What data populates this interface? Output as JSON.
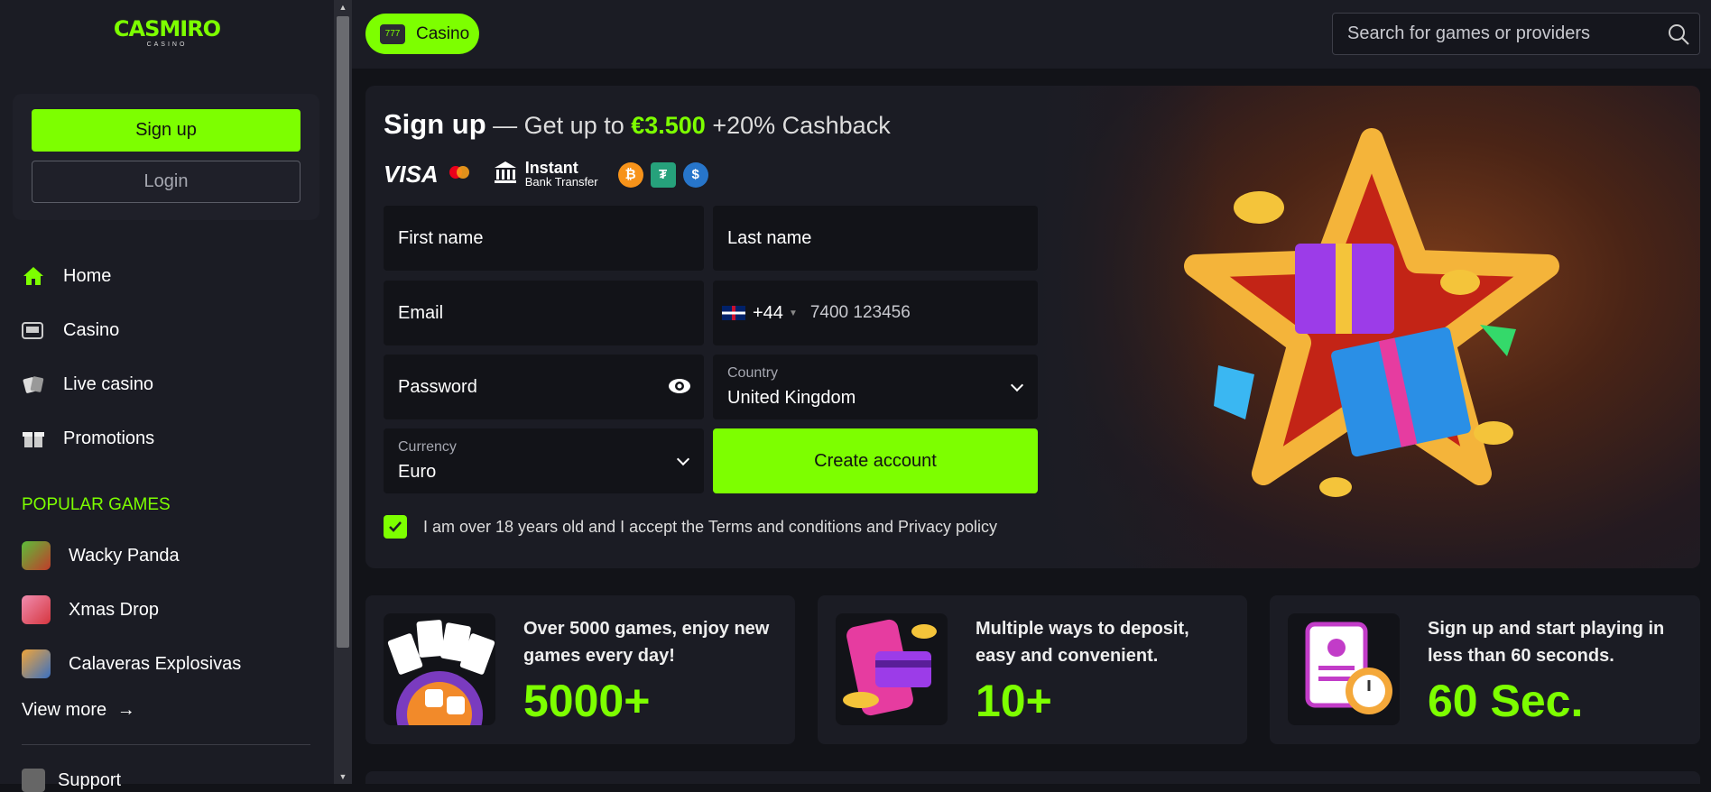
{
  "brand": {
    "name": "CASMIRO",
    "sub": "CASINO"
  },
  "auth": {
    "signup_label": "Sign up",
    "login_label": "Login"
  },
  "nav": [
    {
      "label": "Home",
      "icon": "home-icon"
    },
    {
      "label": "Casino",
      "icon": "slot-machine-icon"
    },
    {
      "label": "Live casino",
      "icon": "cards-icon"
    },
    {
      "label": "Promotions",
      "icon": "gift-icon"
    }
  ],
  "popular": {
    "title": "POPULAR GAMES",
    "games": [
      {
        "label": "Wacky Panda"
      },
      {
        "label": "Xmas Drop"
      },
      {
        "label": "Calaveras Explosivas"
      }
    ],
    "view_more": "View more"
  },
  "support_label": "Support",
  "topbar": {
    "casino_label": "Casino",
    "search_placeholder": "Search for games or providers"
  },
  "signup_form": {
    "headline_strong": "Sign up",
    "headline_mid": " — Get up to ",
    "headline_amount": "€3.500",
    "headline_tail": " +20% Cashback",
    "payments": {
      "visa": "VISA",
      "bank_title": "Instant",
      "bank_sub": "Bank Transfer"
    },
    "first_name": "First name",
    "last_name": "Last name",
    "email": "Email",
    "phone_code": "+44",
    "phone_placeholder": "7400 123456",
    "password": "Password",
    "country_label": "Country",
    "country_value": "United Kingdom",
    "currency_label": "Currency",
    "currency_value": "Euro",
    "create_label": "Create account",
    "terms": "I am over 18 years old and I accept the Terms and conditions and Privacy policy"
  },
  "cards": [
    {
      "text": "Over 5000 games, enjoy new games every day!",
      "big": "5000+"
    },
    {
      "text": "Multiple ways to deposit, easy and convenient.",
      "big": "10+"
    },
    {
      "text": "Sign up and start playing in less than 60 seconds.",
      "big": "60 Sec."
    }
  ],
  "colors": {
    "accent": "#7dff00",
    "bg": "#121318",
    "panel": "#1b1c24"
  }
}
